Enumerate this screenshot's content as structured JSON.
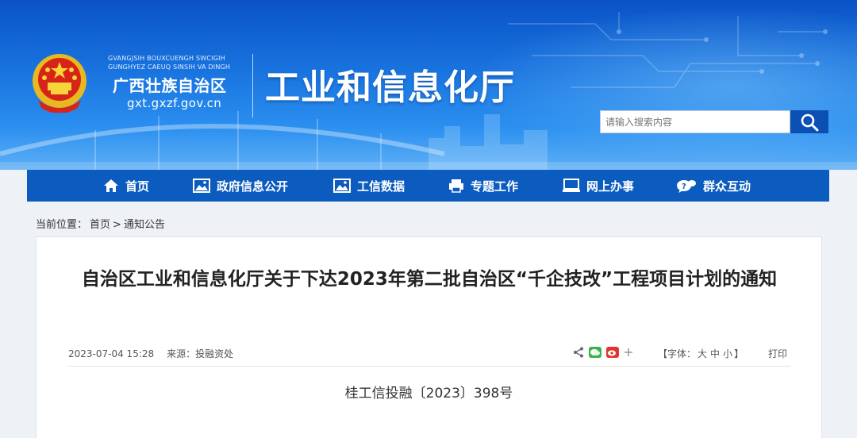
{
  "header": {
    "latin_line1": "GVANGJSIH BOUXCUENGH SWCIGIH",
    "latin_line2": "GUNGHYEZ CAEUQ SINSIH VA DINGH",
    "region_name": "广西壮族自治区",
    "domain": "gxt.gxzf.gov.cn",
    "dept_title": "工业和信息化厅",
    "search_placeholder": "请输入搜索内容",
    "icon_emblem": "national-emblem",
    "icon_search": "search-icon"
  },
  "nav": {
    "items": [
      {
        "label": "首页",
        "icon": "home-icon"
      },
      {
        "label": "政府信息公开",
        "icon": "image-icon"
      },
      {
        "label": "工信数据",
        "icon": "image-icon"
      },
      {
        "label": "专题工作",
        "icon": "printer-icon"
      },
      {
        "label": "网上办事",
        "icon": "monitor-icon"
      },
      {
        "label": "群众互动",
        "icon": "chat-icon"
      }
    ]
  },
  "breadcrumb": {
    "prefix": "当前位置：",
    "home": "首页",
    "sep": ">",
    "current": "通知公告"
  },
  "article": {
    "title": "自治区工业和信息化厅关于下达2023年第二批自治区“千企技改”工程项目计划的通知",
    "datetime": "2023-07-04 15:28",
    "source_label": "来源：",
    "source": "投融资处",
    "fontsize_open": "【字体：",
    "fontsize_large": "大",
    "fontsize_medium": "中",
    "fontsize_small": "小",
    "fontsize_close": "】",
    "print": "打印",
    "doc_number": "桂工信投融〔2023〕398号"
  },
  "colors": {
    "nav_bg": "#0c5bbf",
    "banner_top": "#0a53c7",
    "search_btn": "#0b4fb3"
  }
}
